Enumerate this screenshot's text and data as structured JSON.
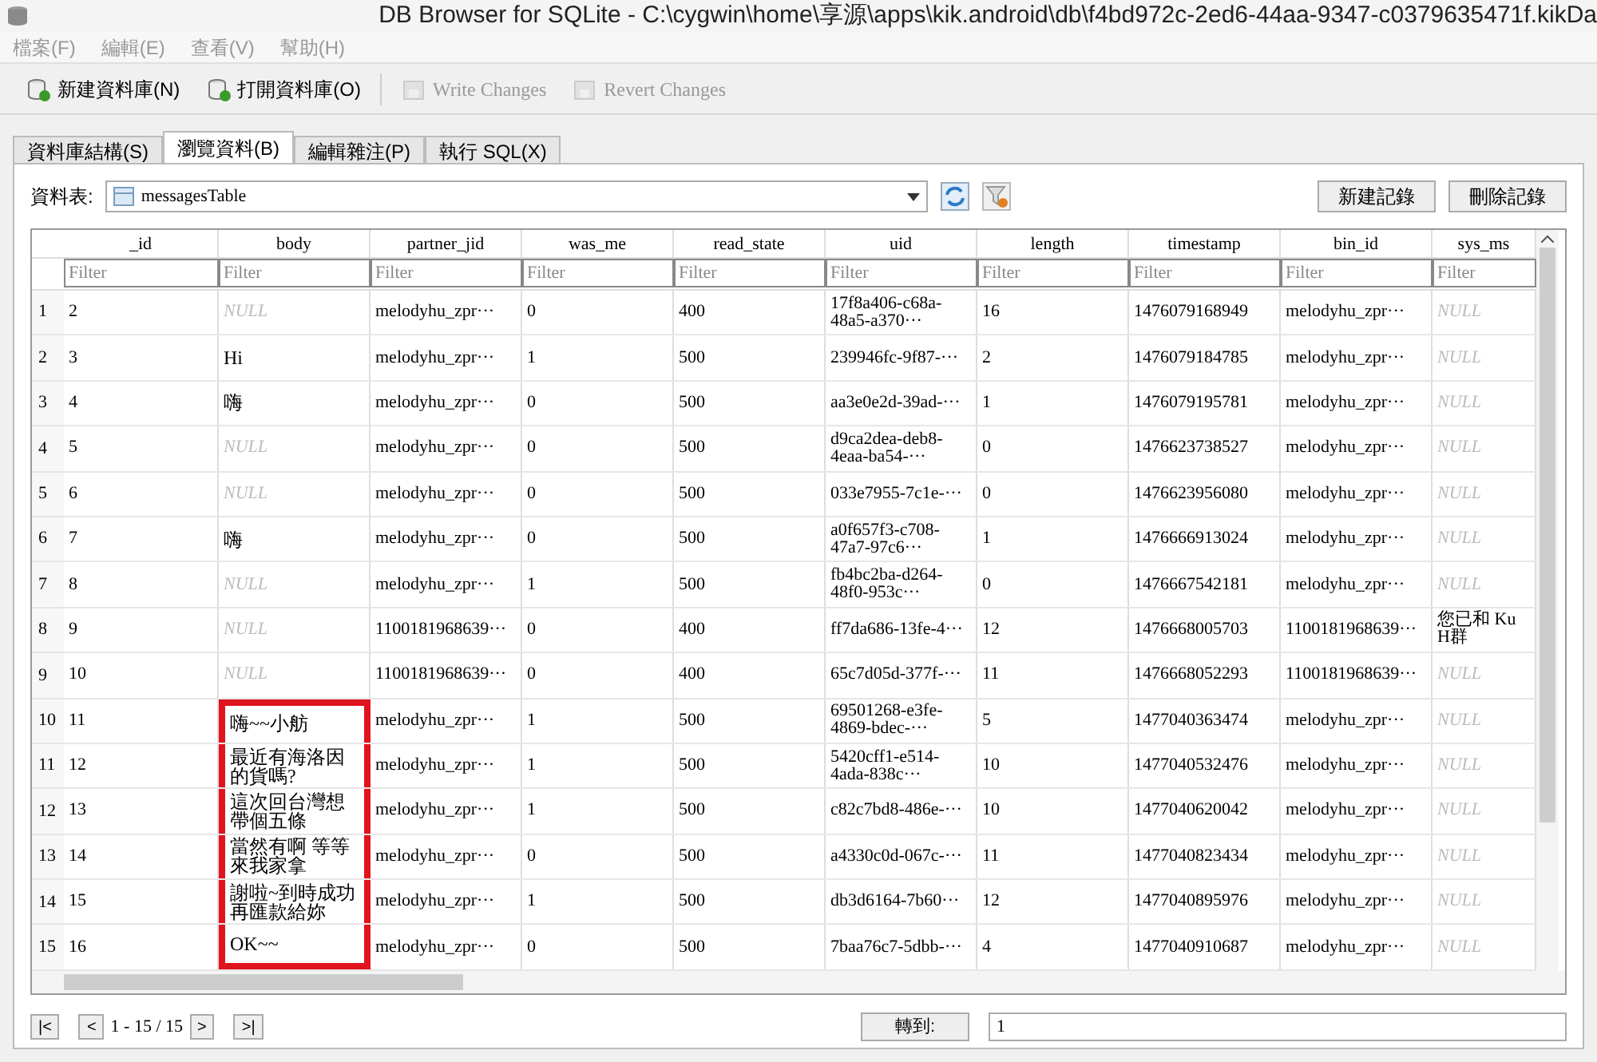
{
  "window": {
    "title": "DB Browser for SQLite - C:\\cygwin\\home\\享源\\apps\\kik.android\\db\\f4bd972c-2ed6-44aa-9347-c0379635471f.kikDa"
  },
  "menu": [
    {
      "label": "檔案(F)",
      "disabled": true
    },
    {
      "label": "編輯(E)",
      "disabled": true
    },
    {
      "label": "查看(V)",
      "disabled": true
    },
    {
      "label": "幫助(H)",
      "disabled": true
    }
  ],
  "toolbar": [
    {
      "label": "新建資料庫(N)",
      "kind": "new",
      "disabled": false
    },
    {
      "label": "打開資料庫(O)",
      "kind": "open",
      "disabled": false
    },
    {
      "label": "Write Changes",
      "kind": "write",
      "disabled": true
    },
    {
      "label": "Revert Changes",
      "kind": "revert",
      "disabled": true
    }
  ],
  "tabs": [
    {
      "label": "資料庫結構(S)",
      "selected": false
    },
    {
      "label": "瀏覽資料(B)",
      "selected": true
    },
    {
      "label": "編輯雜注(P)",
      "selected": false
    },
    {
      "label": "執行 SQL(X)",
      "selected": false
    }
  ],
  "browse": {
    "table_label": "資料表:",
    "table_value": "messagesTable",
    "new_record": "新建記錄",
    "delete_record": "刪除記錄"
  },
  "table": {
    "columns": [
      {
        "label": "_id",
        "filter_placeholder": "Filter"
      },
      {
        "label": "body",
        "filter_placeholder": "Filter"
      },
      {
        "label": "partner_jid",
        "filter_placeholder": "Filter"
      },
      {
        "label": "was_me",
        "filter_placeholder": "Filter"
      },
      {
        "label": "read_state",
        "filter_placeholder": "Filter"
      },
      {
        "label": "uid",
        "filter_placeholder": "Filter"
      },
      {
        "label": "length",
        "filter_placeholder": "Filter"
      },
      {
        "label": "timestamp",
        "filter_placeholder": "Filter"
      },
      {
        "label": "bin_id",
        "filter_placeholder": "Filter"
      },
      {
        "label": "sys_ms",
        "filter_placeholder": "Filter"
      }
    ],
    "rows": [
      {
        "number": "1",
        "highlighted": false,
        "cells": [
          {
            "text": "2",
            "kind": "value"
          },
          {
            "text": "NULL",
            "kind": "null"
          },
          {
            "text": "melodyhu_zpr···",
            "kind": "value"
          },
          {
            "text": "0",
            "kind": "value"
          },
          {
            "text": "400",
            "kind": "value"
          },
          {
            "text": "17f8a406-c68a-48a5-a370···",
            "kind": "value"
          },
          {
            "text": "16",
            "kind": "value"
          },
          {
            "text": "1476079168949",
            "kind": "value"
          },
          {
            "text": "melodyhu_zpr···",
            "kind": "value"
          },
          {
            "text": "NULL",
            "kind": "null"
          }
        ]
      },
      {
        "number": "2",
        "highlighted": false,
        "cells": [
          {
            "text": "3",
            "kind": "value"
          },
          {
            "text": "Hi",
            "kind": "value"
          },
          {
            "text": "melodyhu_zpr···",
            "kind": "value"
          },
          {
            "text": "1",
            "kind": "value"
          },
          {
            "text": "500",
            "kind": "value"
          },
          {
            "text": "239946fc-9f87-···",
            "kind": "value"
          },
          {
            "text": "2",
            "kind": "value"
          },
          {
            "text": "1476079184785",
            "kind": "value"
          },
          {
            "text": "melodyhu_zpr···",
            "kind": "value"
          },
          {
            "text": "NULL",
            "kind": "null"
          }
        ]
      },
      {
        "number": "3",
        "highlighted": false,
        "cells": [
          {
            "text": "4",
            "kind": "value"
          },
          {
            "text": "嗨",
            "kind": "value"
          },
          {
            "text": "melodyhu_zpr···",
            "kind": "value"
          },
          {
            "text": "0",
            "kind": "value"
          },
          {
            "text": "500",
            "kind": "value"
          },
          {
            "text": "aa3e0e2d-39ad-···",
            "kind": "value"
          },
          {
            "text": "1",
            "kind": "value"
          },
          {
            "text": "1476079195781",
            "kind": "value"
          },
          {
            "text": "melodyhu_zpr···",
            "kind": "value"
          },
          {
            "text": "NULL",
            "kind": "null"
          }
        ]
      },
      {
        "number": "4",
        "highlighted": false,
        "cells": [
          {
            "text": "5",
            "kind": "value"
          },
          {
            "text": "NULL",
            "kind": "null"
          },
          {
            "text": "melodyhu_zpr···",
            "kind": "value"
          },
          {
            "text": "0",
            "kind": "value"
          },
          {
            "text": "500",
            "kind": "value"
          },
          {
            "text": "d9ca2dea-deb8-4eaa-ba54-···",
            "kind": "value"
          },
          {
            "text": "0",
            "kind": "value"
          },
          {
            "text": "1476623738527",
            "kind": "value"
          },
          {
            "text": "melodyhu_zpr···",
            "kind": "value"
          },
          {
            "text": "NULL",
            "kind": "null"
          }
        ]
      },
      {
        "number": "5",
        "highlighted": false,
        "cells": [
          {
            "text": "6",
            "kind": "value"
          },
          {
            "text": "NULL",
            "kind": "null"
          },
          {
            "text": "melodyhu_zpr···",
            "kind": "value"
          },
          {
            "text": "0",
            "kind": "value"
          },
          {
            "text": "500",
            "kind": "value"
          },
          {
            "text": "033e7955-7c1e-···",
            "kind": "value"
          },
          {
            "text": "0",
            "kind": "value"
          },
          {
            "text": "1476623956080",
            "kind": "value"
          },
          {
            "text": "melodyhu_zpr···",
            "kind": "value"
          },
          {
            "text": "NULL",
            "kind": "null"
          }
        ]
      },
      {
        "number": "6",
        "highlighted": false,
        "cells": [
          {
            "text": "7",
            "kind": "value"
          },
          {
            "text": "嗨",
            "kind": "value"
          },
          {
            "text": "melodyhu_zpr···",
            "kind": "value"
          },
          {
            "text": "0",
            "kind": "value"
          },
          {
            "text": "500",
            "kind": "value"
          },
          {
            "text": "a0f657f3-c708-47a7-97c6···",
            "kind": "value"
          },
          {
            "text": "1",
            "kind": "value"
          },
          {
            "text": "1476666913024",
            "kind": "value"
          },
          {
            "text": "melodyhu_zpr···",
            "kind": "value"
          },
          {
            "text": "NULL",
            "kind": "null"
          }
        ]
      },
      {
        "number": "7",
        "highlighted": false,
        "cells": [
          {
            "text": "8",
            "kind": "value"
          },
          {
            "text": "NULL",
            "kind": "null"
          },
          {
            "text": "melodyhu_zpr···",
            "kind": "value"
          },
          {
            "text": "1",
            "kind": "value"
          },
          {
            "text": "500",
            "kind": "value"
          },
          {
            "text": "fb4bc2ba-d264-48f0-953c···",
            "kind": "value"
          },
          {
            "text": "0",
            "kind": "value"
          },
          {
            "text": "1476667542181",
            "kind": "value"
          },
          {
            "text": "melodyhu_zpr···",
            "kind": "value"
          },
          {
            "text": "NULL",
            "kind": "null"
          }
        ]
      },
      {
        "number": "8",
        "highlighted": false,
        "cells": [
          {
            "text": "9",
            "kind": "value"
          },
          {
            "text": "NULL",
            "kind": "null"
          },
          {
            "text": "1100181968639···",
            "kind": "value"
          },
          {
            "text": "0",
            "kind": "value"
          },
          {
            "text": "400",
            "kind": "value"
          },
          {
            "text": "ff7da686-13fe-4···",
            "kind": "value"
          },
          {
            "text": "12",
            "kind": "value"
          },
          {
            "text": "1476668005703",
            "kind": "value"
          },
          {
            "text": "1100181968639···",
            "kind": "value"
          },
          {
            "text": "您已和 Ku H群",
            "kind": "value"
          }
        ]
      },
      {
        "number": "9",
        "highlighted": false,
        "cells": [
          {
            "text": "10",
            "kind": "value"
          },
          {
            "text": "NULL",
            "kind": "null"
          },
          {
            "text": "1100181968639···",
            "kind": "value"
          },
          {
            "text": "0",
            "kind": "value"
          },
          {
            "text": "400",
            "kind": "value"
          },
          {
            "text": "65c7d05d-377f-···",
            "kind": "value"
          },
          {
            "text": "11",
            "kind": "value"
          },
          {
            "text": "1476668052293",
            "kind": "value"
          },
          {
            "text": "1100181968639···",
            "kind": "value"
          },
          {
            "text": "NULL",
            "kind": "null"
          }
        ]
      },
      {
        "number": "10",
        "highlighted": true,
        "cells": [
          {
            "text": "11",
            "kind": "value"
          },
          {
            "text": "嗨~~小舫",
            "kind": "value"
          },
          {
            "text": "melodyhu_zpr···",
            "kind": "value"
          },
          {
            "text": "1",
            "kind": "value"
          },
          {
            "text": "500",
            "kind": "value"
          },
          {
            "text": "69501268-e3fe-4869-bdec-···",
            "kind": "value"
          },
          {
            "text": "5",
            "kind": "value"
          },
          {
            "text": "1477040363474",
            "kind": "value"
          },
          {
            "text": "melodyhu_zpr···",
            "kind": "value"
          },
          {
            "text": "NULL",
            "kind": "null"
          }
        ]
      },
      {
        "number": "11",
        "highlighted": true,
        "cells": [
          {
            "text": "12",
            "kind": "value"
          },
          {
            "text": "最近有海洛因的貨嗎?",
            "kind": "value"
          },
          {
            "text": "melodyhu_zpr···",
            "kind": "value"
          },
          {
            "text": "1",
            "kind": "value"
          },
          {
            "text": "500",
            "kind": "value"
          },
          {
            "text": "5420cff1-e514-4ada-838c···",
            "kind": "value"
          },
          {
            "text": "10",
            "kind": "value"
          },
          {
            "text": "1477040532476",
            "kind": "value"
          },
          {
            "text": "melodyhu_zpr···",
            "kind": "value"
          },
          {
            "text": "NULL",
            "kind": "null"
          }
        ]
      },
      {
        "number": "12",
        "highlighted": true,
        "cells": [
          {
            "text": "13",
            "kind": "value"
          },
          {
            "text": "這次回台灣想帶個五條",
            "kind": "value"
          },
          {
            "text": "melodyhu_zpr···",
            "kind": "value"
          },
          {
            "text": "1",
            "kind": "value"
          },
          {
            "text": "500",
            "kind": "value"
          },
          {
            "text": "c82c7bd8-486e-···",
            "kind": "value"
          },
          {
            "text": "10",
            "kind": "value"
          },
          {
            "text": "1477040620042",
            "kind": "value"
          },
          {
            "text": "melodyhu_zpr···",
            "kind": "value"
          },
          {
            "text": "NULL",
            "kind": "null"
          }
        ]
      },
      {
        "number": "13",
        "highlighted": true,
        "cells": [
          {
            "text": "14",
            "kind": "value"
          },
          {
            "text": "當然有啊 等等來我家拿",
            "kind": "value"
          },
          {
            "text": "melodyhu_zpr···",
            "kind": "value"
          },
          {
            "text": "0",
            "kind": "value"
          },
          {
            "text": "500",
            "kind": "value"
          },
          {
            "text": "a4330c0d-067c-···",
            "kind": "value"
          },
          {
            "text": "11",
            "kind": "value"
          },
          {
            "text": "1477040823434",
            "kind": "value"
          },
          {
            "text": "melodyhu_zpr···",
            "kind": "value"
          },
          {
            "text": "NULL",
            "kind": "null"
          }
        ]
      },
      {
        "number": "14",
        "highlighted": true,
        "cells": [
          {
            "text": "15",
            "kind": "value"
          },
          {
            "text": "謝啦~到時成功再匯款給妳",
            "kind": "value"
          },
          {
            "text": "melodyhu_zpr···",
            "kind": "value"
          },
          {
            "text": "1",
            "kind": "value"
          },
          {
            "text": "500",
            "kind": "value"
          },
          {
            "text": "db3d6164-7b60···",
            "kind": "value"
          },
          {
            "text": "12",
            "kind": "value"
          },
          {
            "text": "1477040895976",
            "kind": "value"
          },
          {
            "text": "melodyhu_zpr···",
            "kind": "value"
          },
          {
            "text": "NULL",
            "kind": "null"
          }
        ]
      },
      {
        "number": "15",
        "highlighted": true,
        "cells": [
          {
            "text": "16",
            "kind": "value"
          },
          {
            "text": "OK~~",
            "kind": "value"
          },
          {
            "text": "melodyhu_zpr···",
            "kind": "value"
          },
          {
            "text": "0",
            "kind": "value"
          },
          {
            "text": "500",
            "kind": "value"
          },
          {
            "text": "7baa76c7-5dbb-···",
            "kind": "value"
          },
          {
            "text": "4",
            "kind": "value"
          },
          {
            "text": "1477040910687",
            "kind": "value"
          },
          {
            "text": "melodyhu_zpr···",
            "kind": "value"
          },
          {
            "text": "NULL",
            "kind": "null"
          }
        ]
      }
    ]
  },
  "pager": {
    "first": "|<",
    "prev": "<",
    "range": "1 - 15 / 15",
    "next": ">",
    "last": ">|",
    "goto_button": "轉到:",
    "goto_value": "1"
  }
}
